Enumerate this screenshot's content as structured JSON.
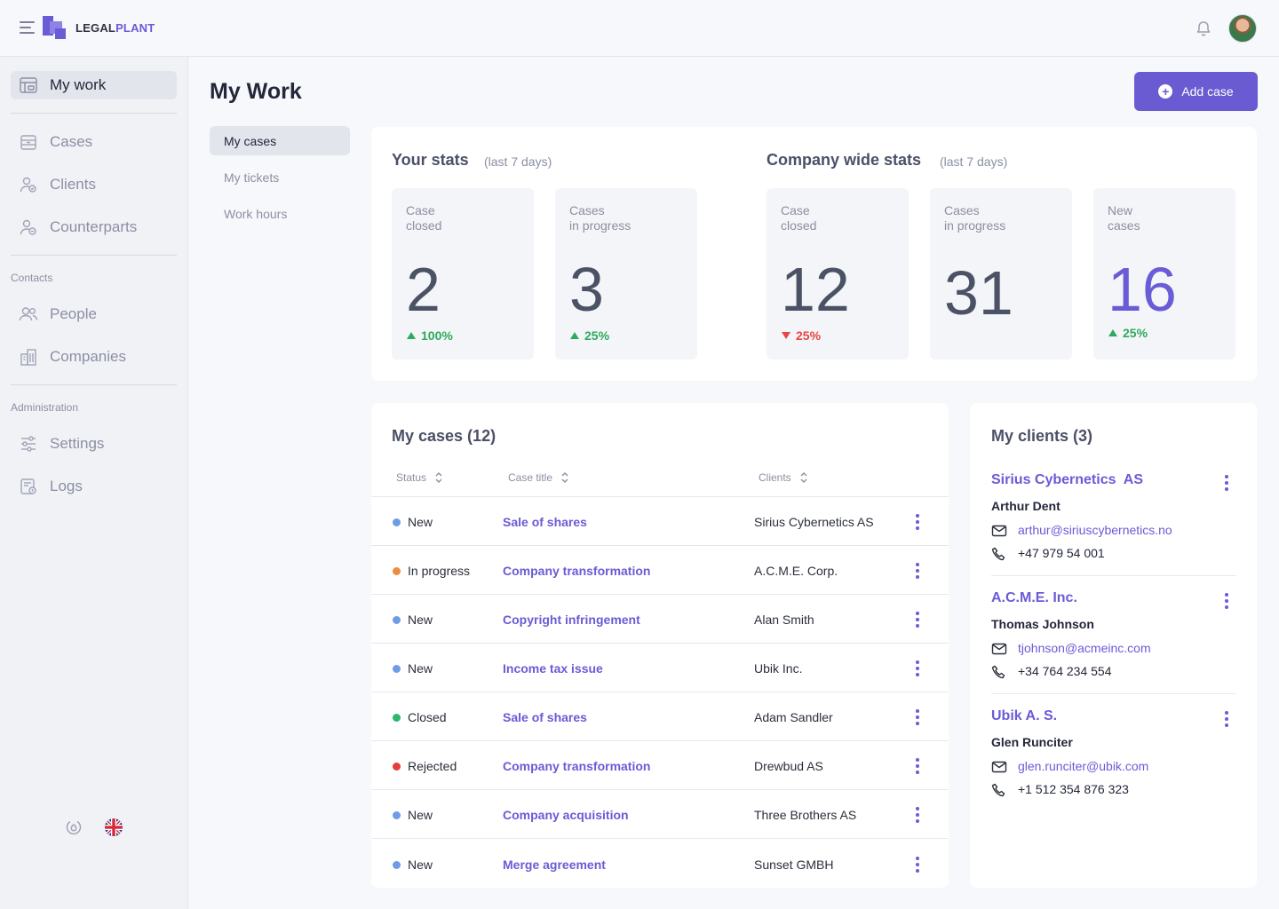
{
  "app": {
    "brand_part1": "LEGAL",
    "brand_part2": "PLANT"
  },
  "sidebar": {
    "items": [
      {
        "label": "My work",
        "icon": "my-work-icon",
        "active": true
      },
      {
        "label": "Cases",
        "icon": "cases-icon"
      },
      {
        "label": "Clients",
        "icon": "clients-icon"
      },
      {
        "label": "Counterparts",
        "icon": "counterparts-icon"
      }
    ],
    "contacts_label": "Contacts",
    "contacts_items": [
      {
        "label": "People",
        "icon": "people-icon"
      },
      {
        "label": "Companies",
        "icon": "companies-icon"
      }
    ],
    "admin_label": "Administration",
    "admin_items": [
      {
        "label": "Settings",
        "icon": "settings-icon"
      },
      {
        "label": "Logs",
        "icon": "logs-icon"
      }
    ]
  },
  "page": {
    "title": "My Work",
    "add_button": "Add case",
    "subnav": [
      "My cases",
      "My tickets",
      "Work hours"
    ]
  },
  "stats": {
    "your_title": "Your stats",
    "your_period": "(last 7 days)",
    "company_title": "Company wide stats",
    "company_period": "(last 7 days)",
    "your": [
      {
        "label_line1": "Case",
        "label_line2": "closed",
        "value": "2",
        "delta": "100%",
        "direction": "up"
      },
      {
        "label_line1": "Cases",
        "label_line2": "in progress",
        "value": "3",
        "delta": "25%",
        "direction": "up"
      }
    ],
    "company": [
      {
        "label_line1": "Case",
        "label_line2": "closed",
        "value": "12",
        "delta": "25%",
        "direction": "down"
      },
      {
        "label_line1": "Cases",
        "label_line2": "in progress",
        "value": "31",
        "delta": "",
        "direction": "none"
      },
      {
        "label_line1": "New",
        "label_line2": "cases",
        "value": "16",
        "delta": "25%",
        "direction": "up"
      }
    ]
  },
  "cases": {
    "title": "My cases (12)",
    "columns": [
      "Status",
      "Case title",
      "Clients"
    ],
    "rows": [
      {
        "status": "New",
        "color": "#6e9ce6",
        "title": "Sale of shares",
        "client": "Sirius Cybernetics  AS"
      },
      {
        "status": "In progress",
        "color": "#f08a3e",
        "title": "Company transformation",
        "client": "A.C.M.E. Corp."
      },
      {
        "status": "New",
        "color": "#6e9ce6",
        "title": "Copyright infringement",
        "client": "Alan Smith"
      },
      {
        "status": "New",
        "color": "#6e9ce6",
        "title": "Income tax issue",
        "client": "Ubik Inc."
      },
      {
        "status": "Closed",
        "color": "#2eb66c",
        "title": "Sale of shares",
        "client": "Adam Sandler"
      },
      {
        "status": "Rejected",
        "color": "#e63c3c",
        "title": "Company transformation",
        "client": "Drewbud AS"
      },
      {
        "status": "New",
        "color": "#6e9ce6",
        "title": "Company acquisition",
        "client": "Three Brothers AS"
      },
      {
        "status": "New",
        "color": "#6e9ce6",
        "title": "Merge agreement",
        "client": "Sunset GMBH"
      }
    ]
  },
  "clients": {
    "title": "My clients (3)",
    "items": [
      {
        "name": "Sirius Cybernetics  AS",
        "contact": "Arthur Dent",
        "email": "arthur@siriuscybernetics.no",
        "phone": "+47 979 54 001"
      },
      {
        "name": "A.C.M.E. Inc.",
        "contact": "Thomas Johnson",
        "email": "tjohnson@acmeinc.com",
        "phone": "+34 764 234 554"
      },
      {
        "name": "Ubik A. S.",
        "contact": "Glen Runciter",
        "email": "glen.runciter@ubik.com",
        "phone": "+1 512 354 876 323"
      }
    ]
  },
  "colors": {
    "accent": "#6b5bd2",
    "positive": "#2eaa5c",
    "negative": "#e64646"
  }
}
